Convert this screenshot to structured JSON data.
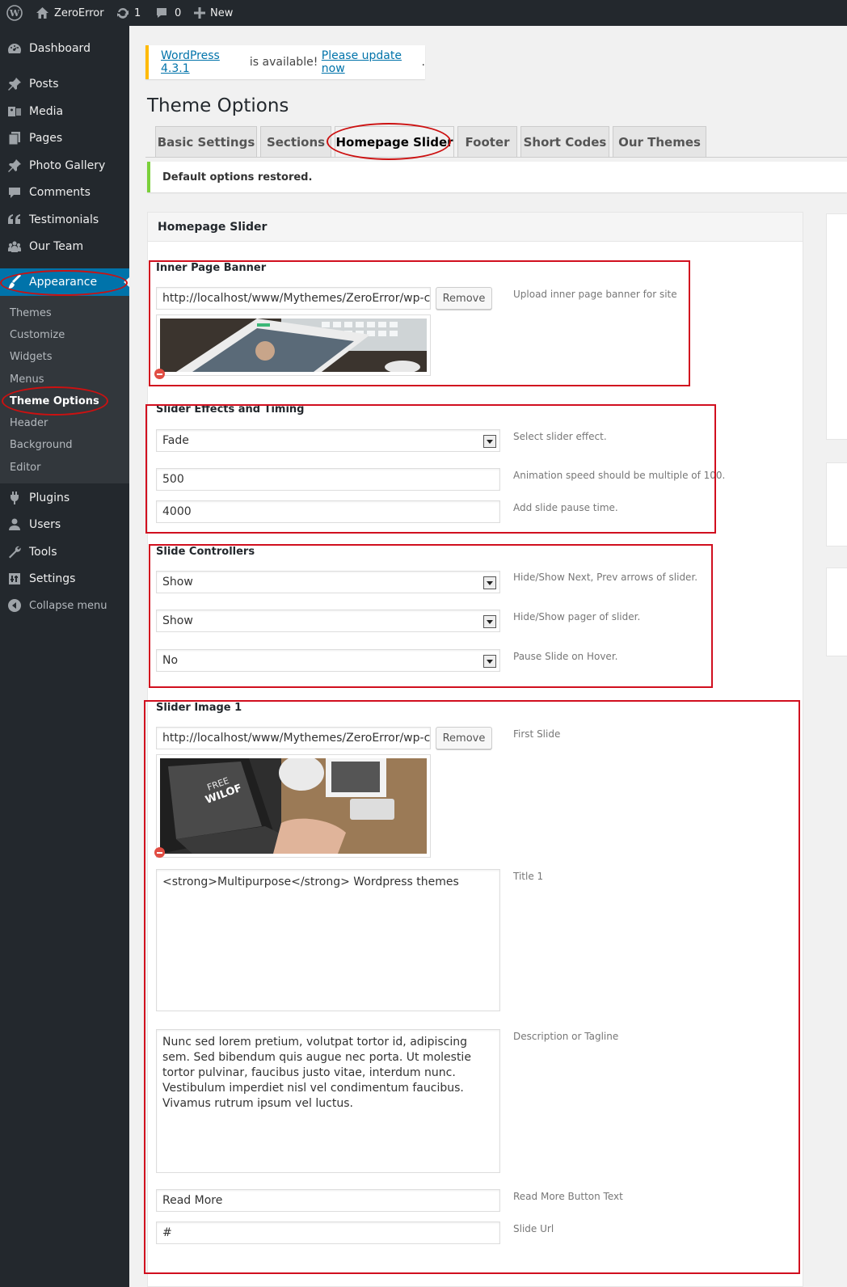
{
  "adminbar": {
    "site_name": "ZeroError",
    "updates_count": "1",
    "comments_count": "0",
    "new_label": "New"
  },
  "sidebar": {
    "items": [
      {
        "label": "Dashboard",
        "icon": "dashboard-icon"
      },
      {
        "label": "Posts",
        "icon": "pin-icon"
      },
      {
        "label": "Media",
        "icon": "media-icon"
      },
      {
        "label": "Pages",
        "icon": "pages-icon"
      },
      {
        "label": "Photo Gallery",
        "icon": "pin-icon"
      },
      {
        "label": "Comments",
        "icon": "comment-icon"
      },
      {
        "label": "Testimonials",
        "icon": "quote-icon"
      },
      {
        "label": "Our Team",
        "icon": "groups-icon"
      },
      {
        "label": "Appearance",
        "icon": "brush-icon"
      },
      {
        "label": "Plugins",
        "icon": "plugin-icon"
      },
      {
        "label": "Users",
        "icon": "users-icon"
      },
      {
        "label": "Tools",
        "icon": "wrench-icon"
      },
      {
        "label": "Settings",
        "icon": "settings-icon"
      },
      {
        "label": "Collapse menu",
        "icon": "collapse-icon"
      }
    ],
    "submenu": [
      "Themes",
      "Customize",
      "Widgets",
      "Menus",
      "Theme Options",
      "Header",
      "Background",
      "Editor"
    ]
  },
  "update_notice": {
    "link1": "WordPress 4.3.1",
    "middle": " is available! ",
    "link2": "Please update now",
    "end": "."
  },
  "page_title": "Theme Options",
  "tabs": [
    "Basic Settings",
    "Sections",
    "Homepage Slider",
    "Footer",
    "Short Codes",
    "Our Themes"
  ],
  "restored_notice": "Default options restored.",
  "panel": {
    "title": "Homepage Slider",
    "banner": {
      "title": "Inner Page Banner",
      "url": "http://localhost/www/Mythemes/ZeroError/wp-cont",
      "remove": "Remove",
      "desc": "Upload inner page banner for site"
    },
    "effects": {
      "title": "Slider Effects and Timing",
      "effect": "Fade",
      "effect_desc": "Select slider effect.",
      "speed": "500",
      "speed_desc": "Animation speed should be multiple of 100.",
      "pause": "4000",
      "pause_desc": "Add slide pause time."
    },
    "controllers": {
      "title": "Slide Controllers",
      "arrows": "Show",
      "arrows_desc": "Hide/Show Next, Prev arrows of slider.",
      "pager": "Show",
      "pager_desc": "Hide/Show pager of slider.",
      "hover": "No",
      "hover_desc": "Pause Slide on Hover."
    },
    "slide1": {
      "title": "Slider Image 1",
      "url": "http://localhost/www/Mythemes/ZeroError/wp-cont",
      "remove": "Remove",
      "desc": "First Slide",
      "slide_title": "<strong>Multipurpose</strong> Wordpress themes",
      "title_desc": "Title 1",
      "description": "Nunc sed lorem pretium, volutpat tortor id, adipiscing sem. Sed bibendum quis augue nec porta. Ut molestie tortor pulvinar, faucibus justo vitae, interdum nunc. Vestibulum imperdiet nisl vel condimentum faucibus. Vivamus rutrum ipsum vel luctus.",
      "description_desc": "Description or Tagline",
      "button_text": "Read More",
      "button_desc": "Read More Button Text",
      "slide_url": "#",
      "url_desc": "Slide Url"
    }
  },
  "colors": {
    "adminbar": "#23282d",
    "accent": "#0073aa",
    "highlight": "#d10f1f"
  }
}
